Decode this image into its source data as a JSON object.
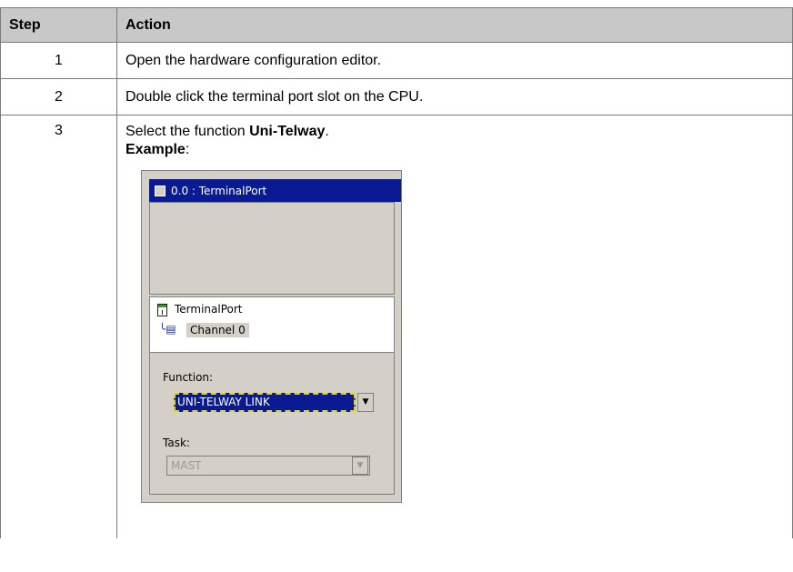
{
  "table": {
    "header": {
      "step": "Step",
      "action": "Action"
    },
    "rows": [
      {
        "step": "1",
        "action": "Open the hardware configuration editor."
      },
      {
        "step": "2",
        "action": "Double click the terminal port slot on the CPU."
      },
      {
        "step": "3",
        "action_prefix": "Select the function ",
        "action_bold": "Uni-Telway",
        "action_suffix": ".",
        "example_label": "Example",
        "example_colon": ":"
      }
    ]
  },
  "dialog": {
    "title": "0.0 : TerminalPort",
    "tree": {
      "module": "TerminalPort",
      "channel": "Channel 0"
    },
    "function": {
      "label": "Function:",
      "value": "UNI-TELWAY LINK"
    },
    "task": {
      "label": "Task:",
      "value": "MAST"
    },
    "icons": {
      "module": "terminal-port-icon",
      "channel": "channel-icon",
      "dropdown": "chevron-down-icon"
    }
  }
}
